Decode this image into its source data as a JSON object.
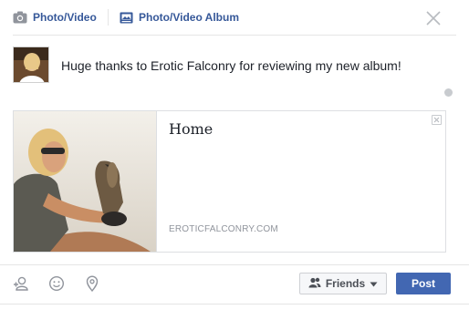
{
  "tabs": {
    "photo_video_label": "Photo/Video",
    "album_label": "Photo/Video Album"
  },
  "status": {
    "text": "Huge thanks to Erotic Falconry for reviewing my new album!"
  },
  "link_preview": {
    "title": "Home",
    "domain": "EROTICFALCONRY.COM"
  },
  "footer": {
    "audience_label": "Friends",
    "post_label": "Post"
  },
  "icons": {
    "camera": "camera-icon",
    "album": "album-icon",
    "close": "close-icon",
    "tag_friends": "tag-friends-icon",
    "feeling": "smiley-icon",
    "location": "location-pin-icon",
    "audience": "friends-icon",
    "dropdown": "caret-down-icon",
    "remove_preview": "remove-preview-icon"
  },
  "colors": {
    "link_blue": "#365899",
    "post_button": "#4267b2",
    "border": "#dddfe2",
    "muted_text": "#90949c"
  }
}
